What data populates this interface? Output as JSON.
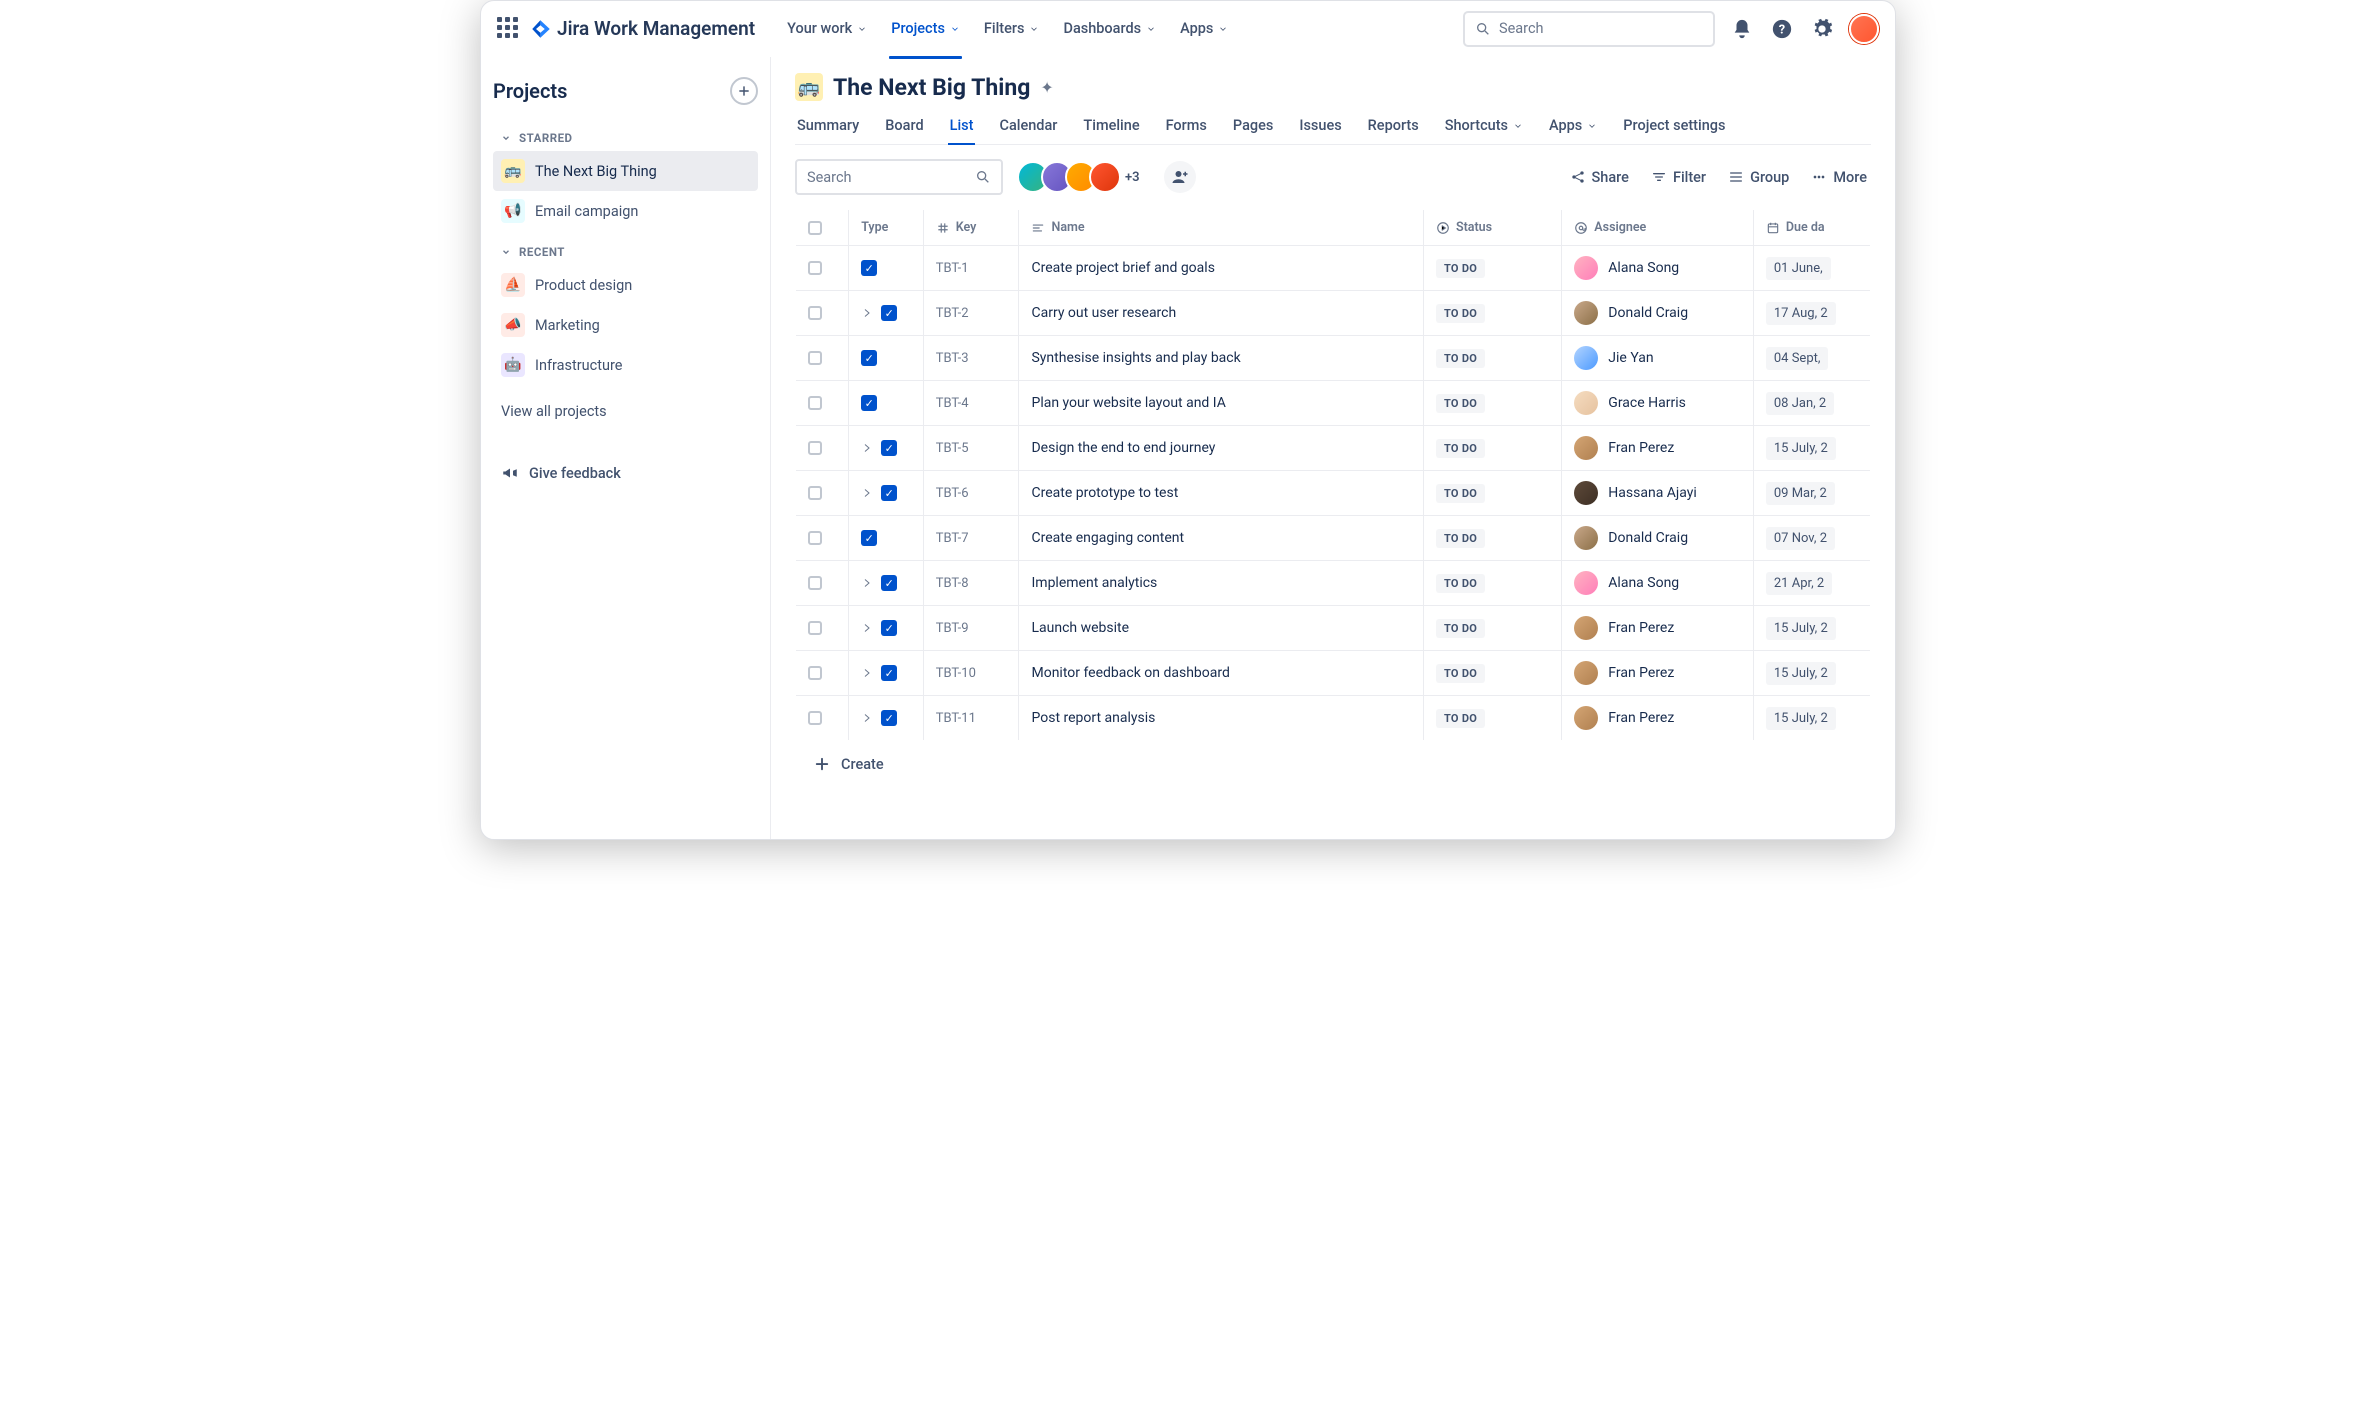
{
  "app": {
    "name": "Jira Work Management"
  },
  "topnav": {
    "items": [
      {
        "label": "Your work",
        "chev": true
      },
      {
        "label": "Projects",
        "chev": true,
        "active": true
      },
      {
        "label": "Filters",
        "chev": true
      },
      {
        "label": "Dashboards",
        "chev": true
      },
      {
        "label": "Apps",
        "chev": true
      }
    ],
    "search_placeholder": "Search"
  },
  "sidebar": {
    "title": "Projects",
    "sections": [
      {
        "label": "STARRED",
        "items": [
          {
            "label": "The Next Big Thing",
            "icon": "🚌",
            "cls": "yellow",
            "active": true
          },
          {
            "label": "Email campaign",
            "icon": "📢",
            "cls": "teal"
          }
        ]
      },
      {
        "label": "RECENT",
        "items": [
          {
            "label": "Product design",
            "icon": "⛵",
            "cls": "orange"
          },
          {
            "label": "Marketing",
            "icon": "📣",
            "cls": "red"
          },
          {
            "label": "Infrastructure",
            "icon": "🤖",
            "cls": "purple"
          }
        ]
      }
    ],
    "view_all": "View all projects",
    "feedback": "Give feedback"
  },
  "project": {
    "title": "The Next Big Thing",
    "icon": "🚌",
    "tabs": [
      "Summary",
      "Board",
      "List",
      "Calendar",
      "Timeline",
      "Forms",
      "Pages",
      "Issues",
      "Reports",
      "Shortcuts",
      "Apps",
      "Project settings"
    ],
    "active_tab": "List"
  },
  "toolbar": {
    "search_placeholder": "Search",
    "extra_count": "+3",
    "share": "Share",
    "filter": "Filter",
    "group": "Group",
    "more": "More"
  },
  "table": {
    "columns": {
      "type": "Type",
      "key": "Key",
      "name": "Name",
      "status": "Status",
      "assignee": "Assignee",
      "due": "Due da"
    },
    "rows": [
      {
        "expand": false,
        "key": "TBT-1",
        "name": "Create project brief and goals",
        "status": "TO DO",
        "assignee": "Alana Song",
        "avcls": "av-pink",
        "due": "01 June,"
      },
      {
        "expand": true,
        "key": "TBT-2",
        "name": "Carry out user research",
        "status": "TO DO",
        "assignee": "Donald Craig",
        "avcls": "av-brown",
        "due": "17 Aug, 2"
      },
      {
        "expand": false,
        "key": "TBT-3",
        "name": "Synthesise insights and play back",
        "status": "TO DO",
        "assignee": "Jie Yan",
        "avcls": "av-blue",
        "due": "04 Sept,"
      },
      {
        "expand": false,
        "key": "TBT-4",
        "name": "Plan your website layout and IA",
        "status": "TO DO",
        "assignee": "Grace Harris",
        "avcls": "av-beige",
        "due": "08 Jan, 2"
      },
      {
        "expand": true,
        "key": "TBT-5",
        "name": "Design the end to end journey",
        "status": "TO DO",
        "assignee": "Fran Perez",
        "avcls": "av-tan",
        "due": "15 July, 2"
      },
      {
        "expand": true,
        "key": "TBT-6",
        "name": "Create prototype to test",
        "status": "TO DO",
        "assignee": "Hassana Ajayi",
        "avcls": "av-dark",
        "due": "09 Mar, 2"
      },
      {
        "expand": false,
        "key": "TBT-7",
        "name": "Create engaging content",
        "status": "TO DO",
        "assignee": "Donald Craig",
        "avcls": "av-brown",
        "due": "07 Nov, 2"
      },
      {
        "expand": true,
        "key": "TBT-8",
        "name": "Implement analytics",
        "status": "TO DO",
        "assignee": "Alana Song",
        "avcls": "av-pink",
        "due": "21 Apr, 2"
      },
      {
        "expand": true,
        "key": "TBT-9",
        "name": "Launch website",
        "status": "TO DO",
        "assignee": "Fran Perez",
        "avcls": "av-tan",
        "due": "15 July, 2"
      },
      {
        "expand": true,
        "key": "TBT-10",
        "name": "Monitor feedback on dashboard",
        "status": "TO DO",
        "assignee": "Fran Perez",
        "avcls": "av-tan",
        "due": "15 July, 2"
      },
      {
        "expand": true,
        "key": "TBT-11",
        "name": "Post report analysis",
        "status": "TO DO",
        "assignee": "Fran Perez",
        "avcls": "av-tan",
        "due": "15 July, 2"
      }
    ],
    "create": "Create"
  }
}
